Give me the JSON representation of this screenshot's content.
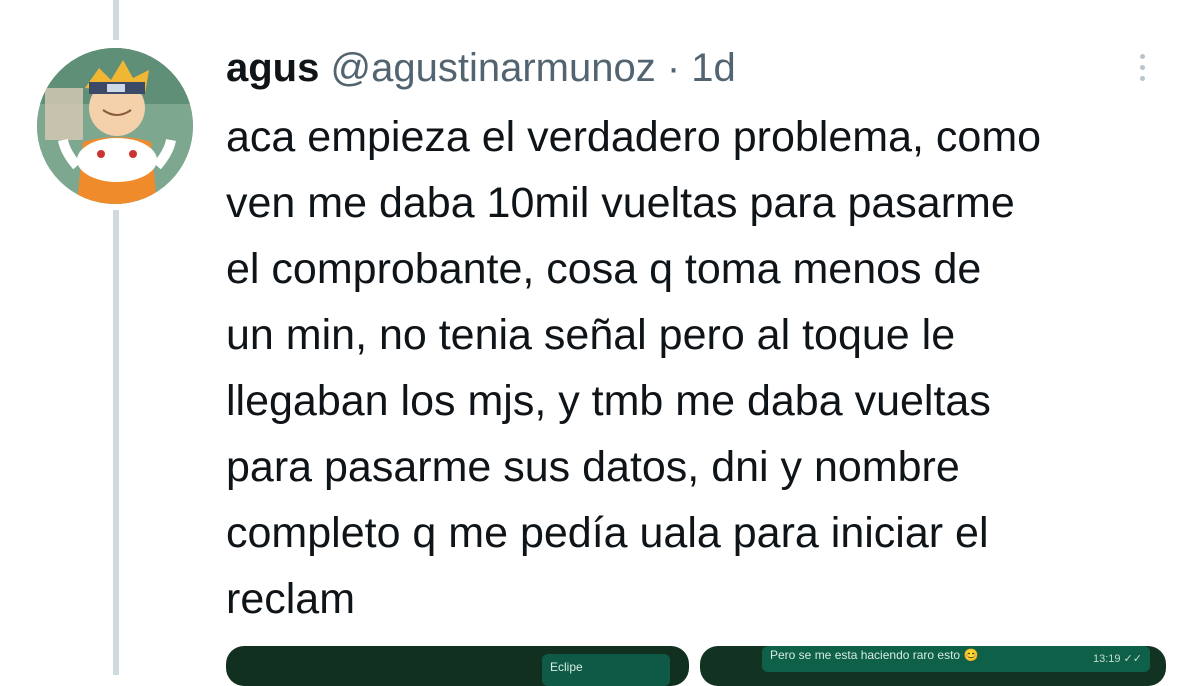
{
  "tweet": {
    "display_name": "agus",
    "handle": "@agustinarmunoz",
    "separator": "·",
    "timestamp": "1d",
    "text": "aca empieza el verdadero problema, como\nven me daba 10mil vueltas para pasarme\nel comprobante, cosa q toma menos de\nun min, no tenia señal pero al toque le\nllegaban los mjs, y tmb me daba vueltas\npara pasarme sus datos, dni y nombre\ncompleto q me pedía uala para iniciar el\nreclam"
  },
  "media": {
    "left_bubble_text": "Eclipe",
    "right_bubble_text": "Pero se me esta haciendo raro esto 😊",
    "right_bubble_time": "13:19 ✓✓"
  },
  "colors": {
    "thread_line": "#cfd9de",
    "secondary_text": "#536471",
    "chat_background": "#123020"
  },
  "icons": {
    "more": "more-vertical-icon",
    "avatar": "anime-avatar"
  }
}
